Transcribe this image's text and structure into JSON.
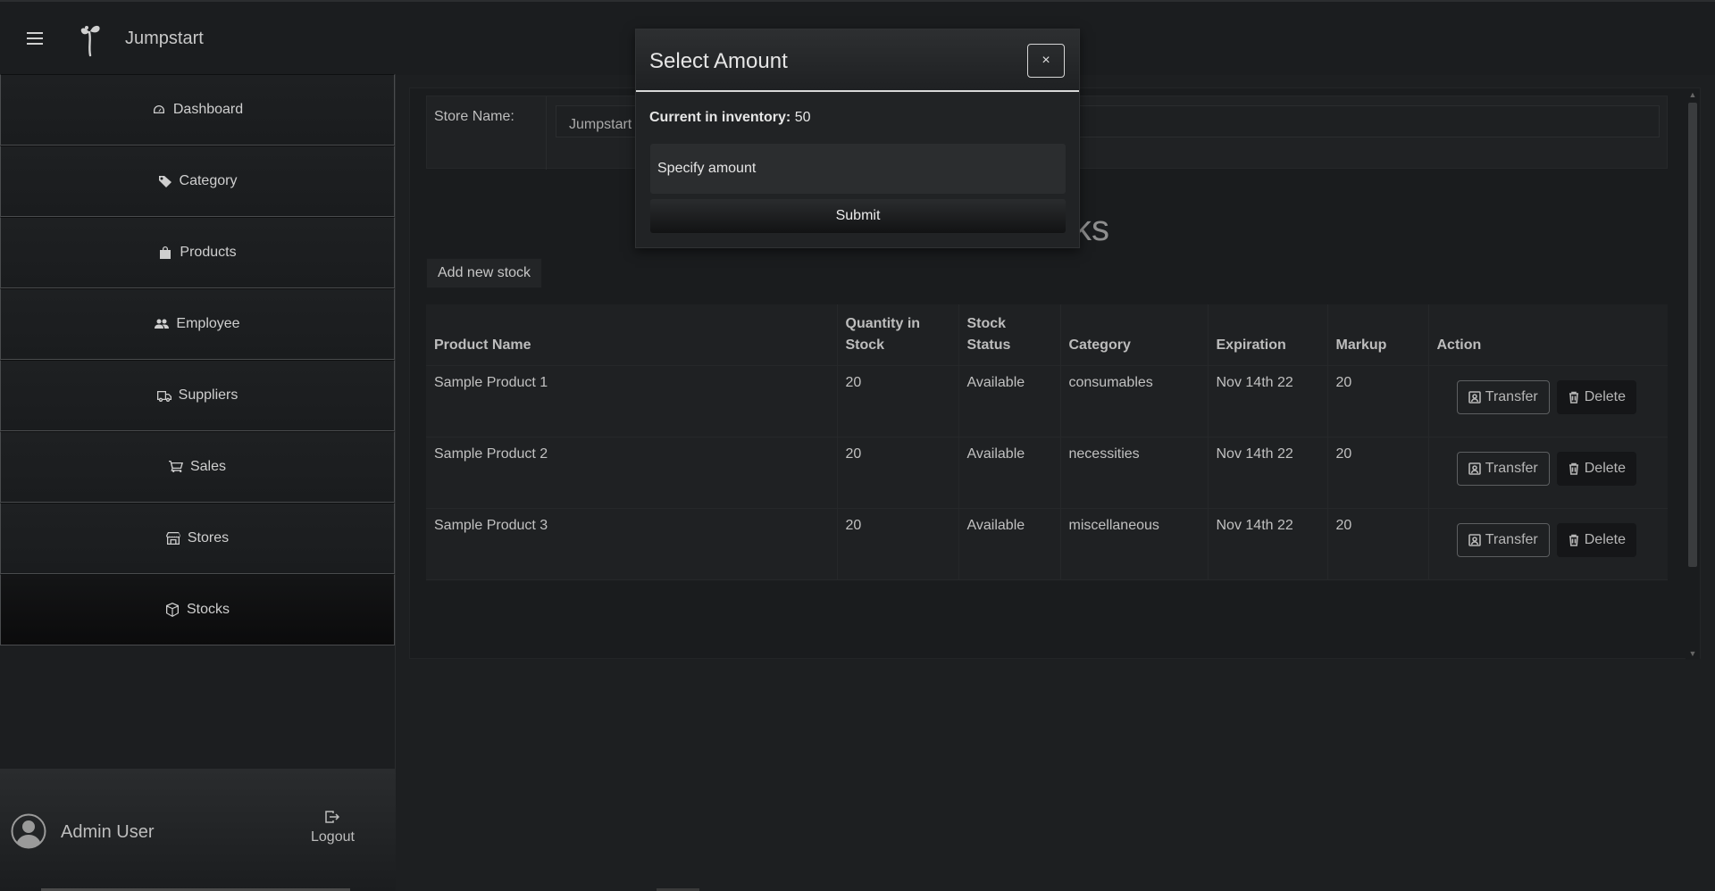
{
  "app": {
    "title": "Jumpstart"
  },
  "sidebar": {
    "items": [
      {
        "label": "Dashboard",
        "icon": "dashboard-icon"
      },
      {
        "label": "Category",
        "icon": "tag-icon"
      },
      {
        "label": "Products",
        "icon": "bag-icon"
      },
      {
        "label": "Employee",
        "icon": "people-icon"
      },
      {
        "label": "Suppliers",
        "icon": "truck-icon"
      },
      {
        "label": "Sales",
        "icon": "cart-icon"
      },
      {
        "label": "Stores",
        "icon": "shop-icon"
      },
      {
        "label": "Stocks",
        "icon": "box-icon"
      }
    ],
    "active": "Stocks",
    "user": {
      "name": "Admin User",
      "logout_label": "Logout"
    }
  },
  "main": {
    "store_label": "Store Name:",
    "store_value": "Jumpstart",
    "page_title": "Stocks",
    "add_stock_label": "Add new stock",
    "table": {
      "headers": [
        "Product Name",
        "Quantity in Stock",
        "Stock Status",
        "Category",
        "Expiration",
        "Markup",
        "Action"
      ],
      "rows": [
        {
          "product": "Sample Product 1",
          "quantity": "20",
          "status": "Available",
          "category": "consumables",
          "expiration": "Nov 14th 22",
          "markup": "20"
        },
        {
          "product": "Sample Product 2",
          "quantity": "20",
          "status": "Available",
          "category": "necessities",
          "expiration": "Nov 14th 22",
          "markup": "20"
        },
        {
          "product": "Sample Product 3",
          "quantity": "20",
          "status": "Available",
          "category": "miscellaneous",
          "expiration": "Nov 14th 22",
          "markup": "20"
        }
      ],
      "transfer_label": "Transfer",
      "delete_label": "Delete"
    }
  },
  "modal": {
    "title": "Select Amount",
    "close_label": "×",
    "inventory_label": "Current in inventory:",
    "inventory_value": "50",
    "amount_placeholder": "Specify amount",
    "submit_label": "Submit"
  }
}
